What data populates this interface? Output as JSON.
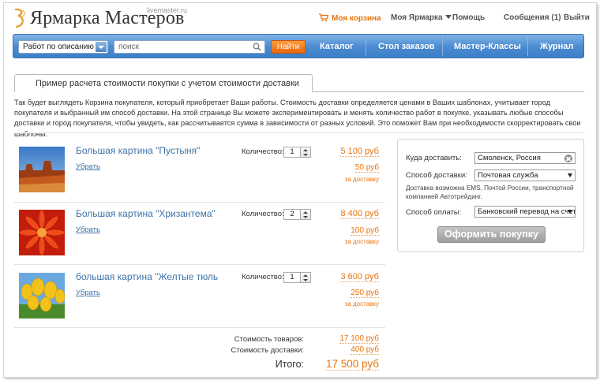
{
  "header": {
    "logo_text": "Ярмарка Мастеров",
    "logo_sub": "livemaster.ru",
    "cart_label": "Моя корзина",
    "my_fair_label": "Моя Ярмарка",
    "help_label": "Помощь",
    "messages_label": "Сообщения (1)",
    "exit_label": "Выйти"
  },
  "searchbar": {
    "select_value": "Работ по описанию",
    "search_placeholder": "поиск",
    "find_label": "Найти",
    "links": [
      "Каталог",
      "Стол заказов",
      "Мастер-Классы",
      "Журнал"
    ]
  },
  "tab_label": "Пример расчета стоимости покупки с учетом стоимости доставки",
  "description": "Так будет выглядеть Корзина покупателя, который приобретает Ваши работы. Стоимость доставки определяется ценами в Ваших шаблонах, учитывает город покупателя и выбранный им способ доставки. На этой странице Вы можете экспериментировать и менять количество работ в покупке, указывать любые способы доставки и город покупателя, чтобы увидеть, как рассчитывается сумма в зависимости от разных условий. Это поможет Вам при необходимости скорректировать свои шаблоны.",
  "products": [
    {
      "name": "Большая картина \"Пустыня\"",
      "remove": "Убрать",
      "qty_label": "Количество:",
      "qty": "1",
      "price": "5 100 руб",
      "ship": "50 руб",
      "ship_note": "за доставку"
    },
    {
      "name": "Большая картина \"Хризантема\"",
      "remove": "Убрать",
      "qty_label": "Количество:",
      "qty": "2",
      "price": "8 400 руб",
      "ship": "100 руб",
      "ship_note": "за доставку"
    },
    {
      "name": "большая картина \"Желтые тюльпаны\"",
      "remove": "Убрать",
      "qty_label": "Количество:",
      "qty": "1",
      "price": "3 600 руб",
      "ship": "250 руб",
      "ship_note": "за доставку"
    }
  ],
  "totals": {
    "goods_label": "Стоимость товаров:",
    "goods_value": "17 100 руб",
    "ship_label": "Стоимость доставки:",
    "ship_value": "400 руб",
    "grand_label": "Итого:",
    "grand_value": "17 500 руб"
  },
  "panel": {
    "deliver_to_label": "Куда доставить:",
    "deliver_to_value": "Смоленск, Россия",
    "method_label": "Способ доставки:",
    "method_value": "Почтовая служба",
    "note": "Доставка возможна EMS, Почтой России, транспортной компанией Автотрейдинг.",
    "pay_label": "Способ оплаты:",
    "pay_value": "Банковский перевод на счет",
    "order_button": "Оформить покупку"
  },
  "colors": {
    "accent": "#e8730c",
    "link": "#3c73a8",
    "bar": "#4a8ad0"
  }
}
